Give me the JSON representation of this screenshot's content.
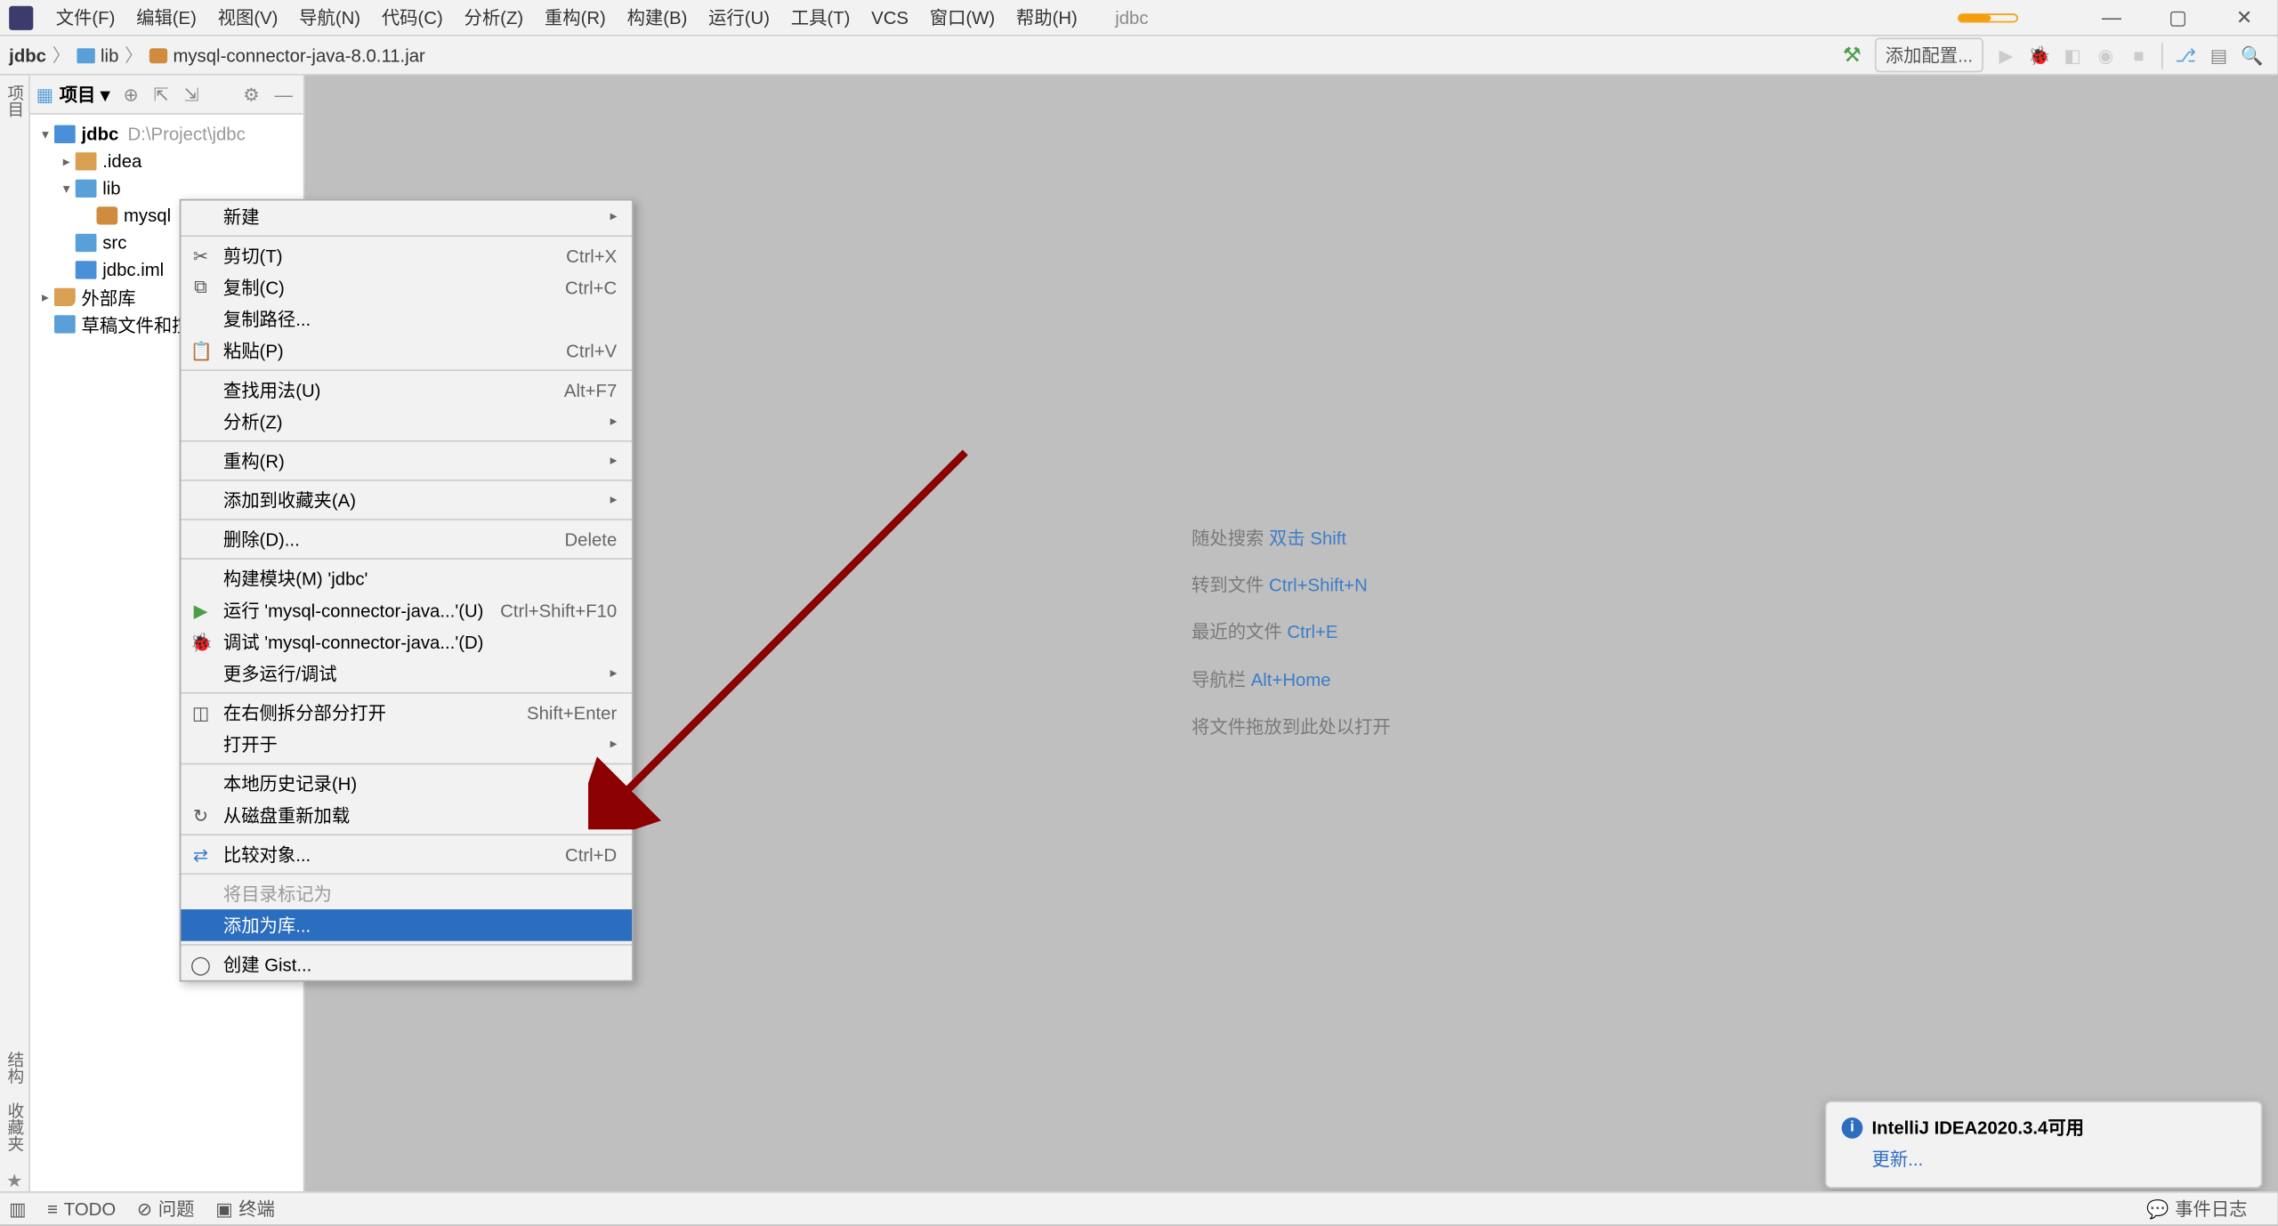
{
  "menubar": {
    "items": [
      "文件(F)",
      "编辑(E)",
      "视图(V)",
      "导航(N)",
      "代码(C)",
      "分析(Z)",
      "重构(R)",
      "构建(B)",
      "运行(U)",
      "工具(T)",
      "VCS",
      "窗口(W)",
      "帮助(H)"
    ],
    "project_title": "jdbc"
  },
  "breadcrumb": {
    "p0": "jdbc",
    "p1": "lib",
    "p2": "mysql-connector-java-8.0.11.jar"
  },
  "toolbar": {
    "add_config": "添加配置..."
  },
  "sidebar": {
    "title": "项目",
    "tree": {
      "root": "jdbc",
      "root_path": "D:\\Project\\jdbc",
      "idea": ".idea",
      "lib": "lib",
      "mysql": "mysql",
      "src": "src",
      "iml": "jdbc.iml",
      "ext": "外部库",
      "scratch": "草稿文件和控"
    }
  },
  "gutter": {
    "top": "项目",
    "fav": "收藏夹",
    "struct": "结构"
  },
  "context_menu": {
    "new": "新建",
    "cut": "剪切(T)",
    "cut_sc": "Ctrl+X",
    "copy": "复制(C)",
    "copy_sc": "Ctrl+C",
    "copy_path": "复制路径...",
    "paste": "粘贴(P)",
    "paste_sc": "Ctrl+V",
    "find_usages": "查找用法(U)",
    "find_usages_sc": "Alt+F7",
    "analyze": "分析(Z)",
    "refactor": "重构(R)",
    "add_fav": "添加到收藏夹(A)",
    "delete": "删除(D)...",
    "delete_sc": "Delete",
    "build_module": "构建模块(M) 'jdbc'",
    "run": "运行 'mysql-connector-java...'(U)",
    "run_sc": "Ctrl+Shift+F10",
    "debug": "调试 'mysql-connector-java...'(D)",
    "more_run": "更多运行/调试",
    "open_right": "在右侧拆分部分打开",
    "open_right_sc": "Shift+Enter",
    "open_in": "打开于",
    "local_history": "本地历史记录(H)",
    "reload": "从磁盘重新加载",
    "compare": "比较对象...",
    "compare_sc": "Ctrl+D",
    "mark_dir": "将目录标记为",
    "add_as_lib": "添加为库...",
    "create_gist": "创建 Gist..."
  },
  "editor_tips": {
    "l1a": "随处搜索 ",
    "l1b": "双击 Shift",
    "l2a": "转到文件 ",
    "l2b": "Ctrl+Shift+N",
    "l3a": "最近的文件 ",
    "l3b": "Ctrl+E",
    "l4a": "导航栏 ",
    "l4b": "Alt+Home",
    "l5": "将文件拖放到此处以打开"
  },
  "toast": {
    "title": "IntelliJ IDEA2020.3.4可用",
    "link": "更新..."
  },
  "statusbar": {
    "todo": "TODO",
    "problems": "问题",
    "terminal": "终端",
    "eventlog": "事件日志"
  }
}
